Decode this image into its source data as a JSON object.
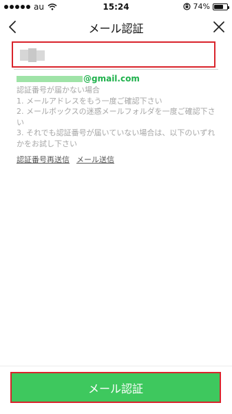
{
  "status_bar": {
    "carrier": "au",
    "time": "15:24",
    "battery_text": "74%",
    "battery_level": 0.74
  },
  "nav": {
    "title": "メール認証",
    "back_icon": "chevron-left-icon",
    "close_icon": "close-icon"
  },
  "code_input": {
    "value": "",
    "placeholder": ""
  },
  "email": {
    "domain": "@gmail.com"
  },
  "help": {
    "heading": "認証番号が届かない場合",
    "items": [
      "1. メールアドレスをもう一度ご確認下さい",
      "2. メールボックスの迷惑メールフォルダを一度ご確認下さい",
      "3. それでも認証番号が届いていない場合は、以下のいずれかをお試し下さい"
    ]
  },
  "links": {
    "resend_code": "認証番号再送信",
    "send_mail": "メール送信"
  },
  "verify_button": {
    "label": "メール認証"
  },
  "colors": {
    "accent_green": "#3ec85e",
    "email_green": "#1fb14c",
    "highlight_red": "#d9232b",
    "help_text": "#a6a6a6"
  }
}
